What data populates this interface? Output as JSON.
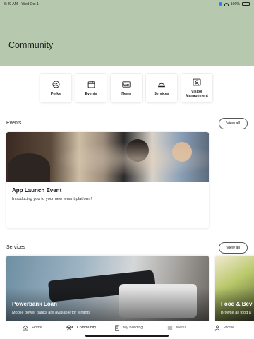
{
  "status_bar": {
    "time": "6:49 AM",
    "date": "Wed Oct 1",
    "battery": "100%"
  },
  "header": {
    "title": "Community"
  },
  "quick_links": [
    {
      "label": "Perks",
      "icon": "perks-icon"
    },
    {
      "label": "Events",
      "icon": "calendar-icon"
    },
    {
      "label": "News",
      "icon": "newspaper-icon"
    },
    {
      "label": "Services",
      "icon": "service-bell-icon"
    },
    {
      "label": "Visitor Management",
      "icon": "visitor-badge-icon"
    }
  ],
  "events": {
    "section_title": "Events",
    "view_all": "View all",
    "card": {
      "title": "App Launch Event",
      "description": "Introducing you to your new tenant platform!"
    }
  },
  "services": {
    "section_title": "Services",
    "view_all": "View all",
    "cards": [
      {
        "title": "Powerbank Loan",
        "description": "Mobile power banks are available for tenants"
      },
      {
        "title": "Food & Bev",
        "description": "Browse all food a"
      }
    ]
  },
  "tab_bar": {
    "items": [
      {
        "label": "Home",
        "icon": "home-icon",
        "active": false
      },
      {
        "label": "Community",
        "icon": "community-icon",
        "active": true
      },
      {
        "label": "My Building",
        "icon": "building-icon",
        "active": false
      },
      {
        "label": "Menu",
        "icon": "menu-icon",
        "active": false
      },
      {
        "label": "Profile",
        "icon": "profile-icon",
        "active": false
      }
    ]
  },
  "colors": {
    "header_background": "#b6c8ae",
    "accent": "#2f7cf6"
  }
}
